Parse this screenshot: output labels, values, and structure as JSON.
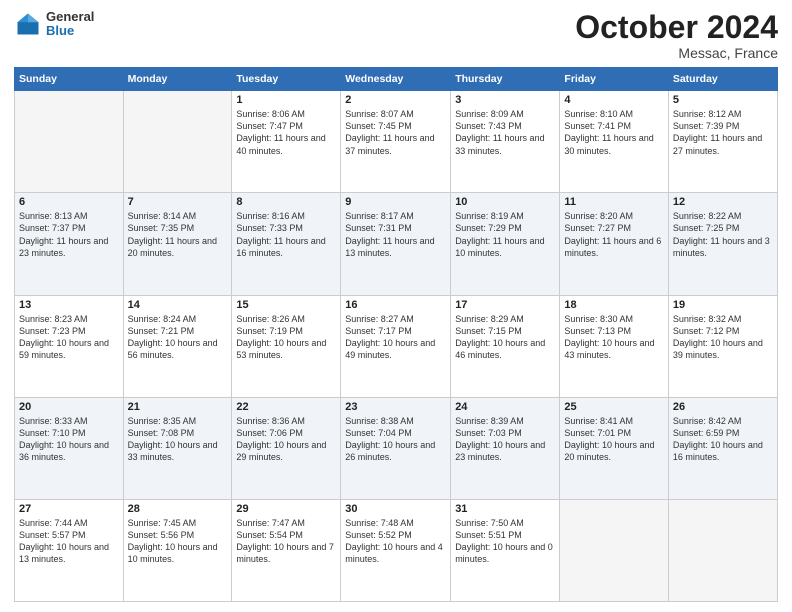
{
  "header": {
    "logo": {
      "general": "General",
      "blue": "Blue"
    },
    "title": "October 2024",
    "location": "Messac, France"
  },
  "weekdays": [
    "Sunday",
    "Monday",
    "Tuesday",
    "Wednesday",
    "Thursday",
    "Friday",
    "Saturday"
  ],
  "weeks": [
    [
      {
        "day": "",
        "detail": ""
      },
      {
        "day": "",
        "detail": ""
      },
      {
        "day": "1",
        "detail": "Sunrise: 8:06 AM\nSunset: 7:47 PM\nDaylight: 11 hours and 40 minutes."
      },
      {
        "day": "2",
        "detail": "Sunrise: 8:07 AM\nSunset: 7:45 PM\nDaylight: 11 hours and 37 minutes."
      },
      {
        "day": "3",
        "detail": "Sunrise: 8:09 AM\nSunset: 7:43 PM\nDaylight: 11 hours and 33 minutes."
      },
      {
        "day": "4",
        "detail": "Sunrise: 8:10 AM\nSunset: 7:41 PM\nDaylight: 11 hours and 30 minutes."
      },
      {
        "day": "5",
        "detail": "Sunrise: 8:12 AM\nSunset: 7:39 PM\nDaylight: 11 hours and 27 minutes."
      }
    ],
    [
      {
        "day": "6",
        "detail": "Sunrise: 8:13 AM\nSunset: 7:37 PM\nDaylight: 11 hours and 23 minutes."
      },
      {
        "day": "7",
        "detail": "Sunrise: 8:14 AM\nSunset: 7:35 PM\nDaylight: 11 hours and 20 minutes."
      },
      {
        "day": "8",
        "detail": "Sunrise: 8:16 AM\nSunset: 7:33 PM\nDaylight: 11 hours and 16 minutes."
      },
      {
        "day": "9",
        "detail": "Sunrise: 8:17 AM\nSunset: 7:31 PM\nDaylight: 11 hours and 13 minutes."
      },
      {
        "day": "10",
        "detail": "Sunrise: 8:19 AM\nSunset: 7:29 PM\nDaylight: 11 hours and 10 minutes."
      },
      {
        "day": "11",
        "detail": "Sunrise: 8:20 AM\nSunset: 7:27 PM\nDaylight: 11 hours and 6 minutes."
      },
      {
        "day": "12",
        "detail": "Sunrise: 8:22 AM\nSunset: 7:25 PM\nDaylight: 11 hours and 3 minutes."
      }
    ],
    [
      {
        "day": "13",
        "detail": "Sunrise: 8:23 AM\nSunset: 7:23 PM\nDaylight: 10 hours and 59 minutes."
      },
      {
        "day": "14",
        "detail": "Sunrise: 8:24 AM\nSunset: 7:21 PM\nDaylight: 10 hours and 56 minutes."
      },
      {
        "day": "15",
        "detail": "Sunrise: 8:26 AM\nSunset: 7:19 PM\nDaylight: 10 hours and 53 minutes."
      },
      {
        "day": "16",
        "detail": "Sunrise: 8:27 AM\nSunset: 7:17 PM\nDaylight: 10 hours and 49 minutes."
      },
      {
        "day": "17",
        "detail": "Sunrise: 8:29 AM\nSunset: 7:15 PM\nDaylight: 10 hours and 46 minutes."
      },
      {
        "day": "18",
        "detail": "Sunrise: 8:30 AM\nSunset: 7:13 PM\nDaylight: 10 hours and 43 minutes."
      },
      {
        "day": "19",
        "detail": "Sunrise: 8:32 AM\nSunset: 7:12 PM\nDaylight: 10 hours and 39 minutes."
      }
    ],
    [
      {
        "day": "20",
        "detail": "Sunrise: 8:33 AM\nSunset: 7:10 PM\nDaylight: 10 hours and 36 minutes."
      },
      {
        "day": "21",
        "detail": "Sunrise: 8:35 AM\nSunset: 7:08 PM\nDaylight: 10 hours and 33 minutes."
      },
      {
        "day": "22",
        "detail": "Sunrise: 8:36 AM\nSunset: 7:06 PM\nDaylight: 10 hours and 29 minutes."
      },
      {
        "day": "23",
        "detail": "Sunrise: 8:38 AM\nSunset: 7:04 PM\nDaylight: 10 hours and 26 minutes."
      },
      {
        "day": "24",
        "detail": "Sunrise: 8:39 AM\nSunset: 7:03 PM\nDaylight: 10 hours and 23 minutes."
      },
      {
        "day": "25",
        "detail": "Sunrise: 8:41 AM\nSunset: 7:01 PM\nDaylight: 10 hours and 20 minutes."
      },
      {
        "day": "26",
        "detail": "Sunrise: 8:42 AM\nSunset: 6:59 PM\nDaylight: 10 hours and 16 minutes."
      }
    ],
    [
      {
        "day": "27",
        "detail": "Sunrise: 7:44 AM\nSunset: 5:57 PM\nDaylight: 10 hours and 13 minutes."
      },
      {
        "day": "28",
        "detail": "Sunrise: 7:45 AM\nSunset: 5:56 PM\nDaylight: 10 hours and 10 minutes."
      },
      {
        "day": "29",
        "detail": "Sunrise: 7:47 AM\nSunset: 5:54 PM\nDaylight: 10 hours and 7 minutes."
      },
      {
        "day": "30",
        "detail": "Sunrise: 7:48 AM\nSunset: 5:52 PM\nDaylight: 10 hours and 4 minutes."
      },
      {
        "day": "31",
        "detail": "Sunrise: 7:50 AM\nSunset: 5:51 PM\nDaylight: 10 hours and 0 minutes."
      },
      {
        "day": "",
        "detail": ""
      },
      {
        "day": "",
        "detail": ""
      }
    ]
  ]
}
